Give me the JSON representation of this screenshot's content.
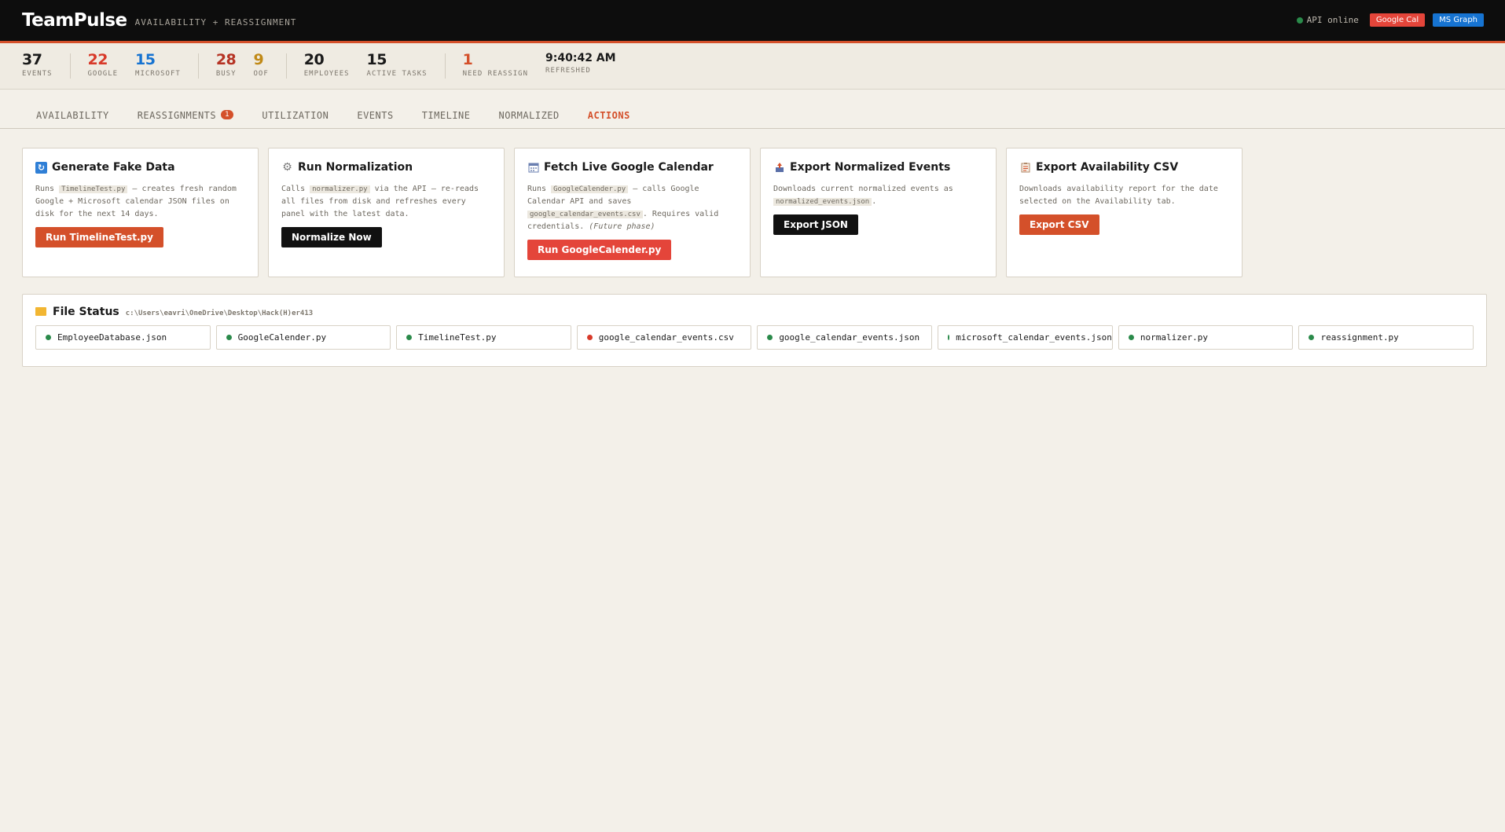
{
  "header": {
    "logo": "TeamPulse",
    "subtitle": "AVAILABILITY + REASSIGNMENT",
    "api_status": "API online",
    "google_pill": "Google Cal",
    "ms_pill": "MS Graph"
  },
  "stats": {
    "events": {
      "value": "37",
      "label": "EVENTS"
    },
    "google": {
      "value": "22",
      "label": "GOOGLE"
    },
    "microsoft": {
      "value": "15",
      "label": "MICROSOFT"
    },
    "busy": {
      "value": "28",
      "label": "BUSY"
    },
    "oof": {
      "value": "9",
      "label": "OOF"
    },
    "employees": {
      "value": "20",
      "label": "EMPLOYEES"
    },
    "active_tasks": {
      "value": "15",
      "label": "ACTIVE TASKS"
    },
    "need_reassign": {
      "value": "1",
      "label": "NEED REASSIGN"
    },
    "refreshed": {
      "value": "9:40:42 AM",
      "label": "REFRESHED"
    }
  },
  "tabs": [
    {
      "label": "AVAILABILITY"
    },
    {
      "label": "REASSIGNMENTS",
      "badge": "1"
    },
    {
      "label": "UTILIZATION"
    },
    {
      "label": "EVENTS"
    },
    {
      "label": "TIMELINE"
    },
    {
      "label": "NORMALIZED"
    },
    {
      "label": "ACTIONS",
      "active": true
    }
  ],
  "cards": {
    "fake": {
      "icon": "refresh-icon",
      "title": "Generate Fake Data",
      "pre": "Runs ",
      "code": "TimelineTest.py",
      "post": " — creates fresh random Google + Microsoft calendar JSON files on disk for the next 14 days.",
      "button": "Run TimelineTest.py"
    },
    "normalize": {
      "icon": "gear-icon",
      "title": "Run Normalization",
      "pre": "Calls ",
      "code": "normalizer.py",
      "post": " via the API — re-reads all files from disk and refreshes every panel with the latest data.",
      "button": "Normalize Now"
    },
    "google": {
      "icon": "calendar-icon",
      "title": "Fetch Live Google Calendar",
      "pre": "Runs ",
      "code": "GoogleCalender.py",
      "mid": " — calls Google Calendar API and saves ",
      "code2": "google_calendar_events.csv",
      "post": ". Requires valid credentials. ",
      "italic": "(Future phase)",
      "button": "Run GoogleCalender.py"
    },
    "export_json": {
      "icon": "export-icon",
      "title": "Export Normalized Events",
      "pre": "Downloads current normalized events as ",
      "code": "normalized_events.json",
      "post": ".",
      "button": "Export JSON"
    },
    "export_csv": {
      "icon": "clipboard-icon",
      "title": "Export Availability CSV",
      "text": "Downloads availability report for the date selected on the Availability tab.",
      "button": "Export CSV"
    }
  },
  "file_status": {
    "title": "File Status",
    "path": "c:\\Users\\eavri\\OneDrive\\Desktop\\Hack(H)er413",
    "files": [
      {
        "name": "EmployeeDatabase.json",
        "status": "ok"
      },
      {
        "name": "GoogleCalender.py",
        "status": "ok"
      },
      {
        "name": "TimelineTest.py",
        "status": "ok"
      },
      {
        "name": "google_calendar_events.csv",
        "status": "missing"
      },
      {
        "name": "google_calendar_events.json",
        "status": "ok"
      },
      {
        "name": "microsoft_calendar_events.json",
        "status": "ok"
      },
      {
        "name": "normalizer.py",
        "status": "ok"
      },
      {
        "name": "reassignment.py",
        "status": "ok"
      }
    ]
  },
  "colors": {
    "accent": "#d4502a",
    "ok": "#2a8a4a",
    "missing": "#d83a2a",
    "google": "#e4453a",
    "microsoft": "#1673d1"
  }
}
